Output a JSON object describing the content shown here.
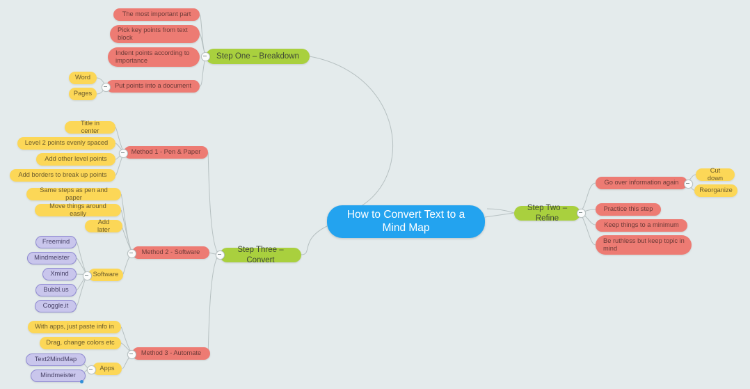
{
  "app": {
    "background_color": "#e4ebec",
    "canvas_name": "mind-map-canvas"
  },
  "palette": {
    "root": "#23a3ef",
    "green": "#a9d03e",
    "red": "#ed7b73",
    "yellow": "#fcd757",
    "purple": "#c9c6ec",
    "edge": "#b6c0c1"
  },
  "root": {
    "label": "How to Convert Text to a Mind Map"
  },
  "branches": {
    "step_one": {
      "label": "Step One – Breakdown",
      "children": [
        {
          "label": "The most important part"
        },
        {
          "label": "Pick key points from text block"
        },
        {
          "label": "Indent points according to importance"
        },
        {
          "label": "Put points into a document",
          "children": [
            {
              "label": "Word"
            },
            {
              "label": "Pages"
            }
          ]
        }
      ]
    },
    "step_two": {
      "label": "Step Two – Refine",
      "children": [
        {
          "label": "Go over information again",
          "children": [
            {
              "label": "Cut down"
            },
            {
              "label": "Reorganize"
            }
          ]
        },
        {
          "label": "Practice this step"
        },
        {
          "label": "Keep things to a minimum"
        },
        {
          "label": "Be ruthless but keep topic in mind"
        }
      ]
    },
    "step_three": {
      "label": "Step Three – Convert",
      "children": [
        {
          "label": "Method 1 - Pen & Paper",
          "children": [
            {
              "label": "Title in center"
            },
            {
              "label": "Level 2 points evenly spaced"
            },
            {
              "label": "Add other level points"
            },
            {
              "label": "Add borders to break up points"
            }
          ]
        },
        {
          "label": "Method 2 - Software",
          "children": [
            {
              "label": "Same steps as pen and paper"
            },
            {
              "label": "Move things around easily"
            },
            {
              "label": "Add later"
            },
            {
              "label": "Software",
              "children": [
                {
                  "label": "Freemind"
                },
                {
                  "label": "Mindmeister"
                },
                {
                  "label": "Xmind"
                },
                {
                  "label": "Bubbl.us"
                },
                {
                  "label": "Coggle.it"
                }
              ]
            }
          ]
        },
        {
          "label": "Method 3 - Automate",
          "children": [
            {
              "label": "With apps, just paste info in"
            },
            {
              "label": "Drag, change colors etc"
            },
            {
              "label": "Apps",
              "children": [
                {
                  "label": "Text2MindMap"
                },
                {
                  "label": "Mindmeister"
                }
              ]
            }
          ]
        }
      ]
    }
  }
}
